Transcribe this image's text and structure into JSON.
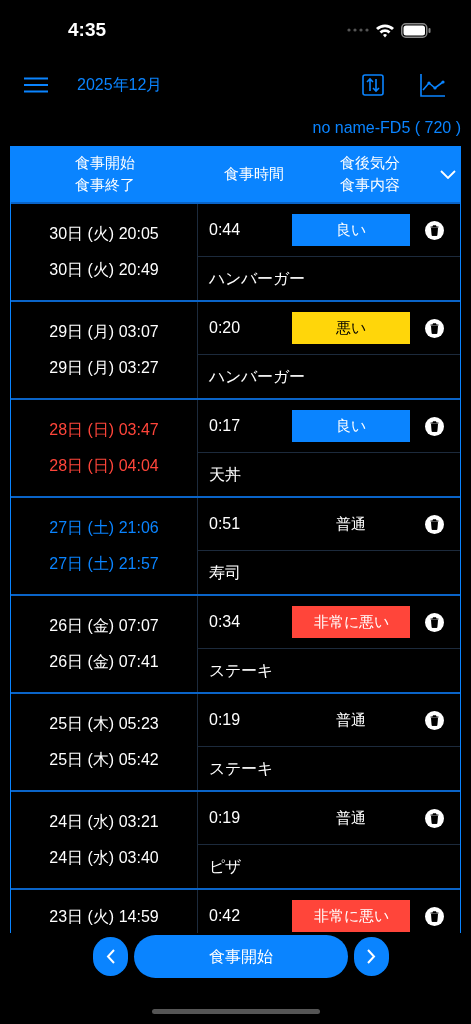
{
  "status_bar": {
    "time": "4:35"
  },
  "nav": {
    "title": "2025年12月"
  },
  "device": "no name-FD5 ( 720 )",
  "table": {
    "columns": [
      [
        "食事開始",
        "食事終了"
      ],
      [
        "食事時間"
      ],
      [
        "食後気分",
        "食事内容"
      ]
    ],
    "rows": [
      {
        "start": "30日 (火) 20:05",
        "end": "30日 (火) 20:49",
        "color": "#ffffff",
        "duration": "0:44",
        "mood": "良い",
        "kind": "good",
        "food": "ハンバーガー"
      },
      {
        "start": "29日 (月) 03:07",
        "end": "29日 (月) 03:27",
        "color": "#ffffff",
        "duration": "0:20",
        "mood": "悪い",
        "kind": "bad",
        "food": "ハンバーガー"
      },
      {
        "start": "28日 (日) 03:47",
        "end": "28日 (日) 04:04",
        "color": "#ff453a",
        "duration": "0:17",
        "mood": "良い",
        "kind": "good",
        "food": "天丼"
      },
      {
        "start": "27日 (土) 21:06",
        "end": "27日 (土) 21:57",
        "color": "#0a84ff",
        "duration": "0:51",
        "mood": "普通",
        "kind": "normal",
        "food": "寿司"
      },
      {
        "start": "26日 (金) 07:07",
        "end": "26日 (金) 07:41",
        "color": "#ffffff",
        "duration": "0:34",
        "mood": "非常に悪い",
        "kind": "very_bad",
        "food": "ステーキ"
      },
      {
        "start": "25日 (木) 05:23",
        "end": "25日 (木) 05:42",
        "color": "#ffffff",
        "duration": "0:19",
        "mood": "普通",
        "kind": "normal",
        "food": "ステーキ"
      },
      {
        "start": "24日 (水) 03:21",
        "end": "24日 (水) 03:40",
        "color": "#ffffff",
        "duration": "0:19",
        "mood": "普通",
        "kind": "normal",
        "food": "ピザ"
      },
      {
        "start": "23日 (火) 14:59",
        "color": "#ffffff",
        "duration": "0:42",
        "mood": "非常に悪い",
        "kind": "very_bad"
      }
    ]
  },
  "start_button": "食事開始"
}
